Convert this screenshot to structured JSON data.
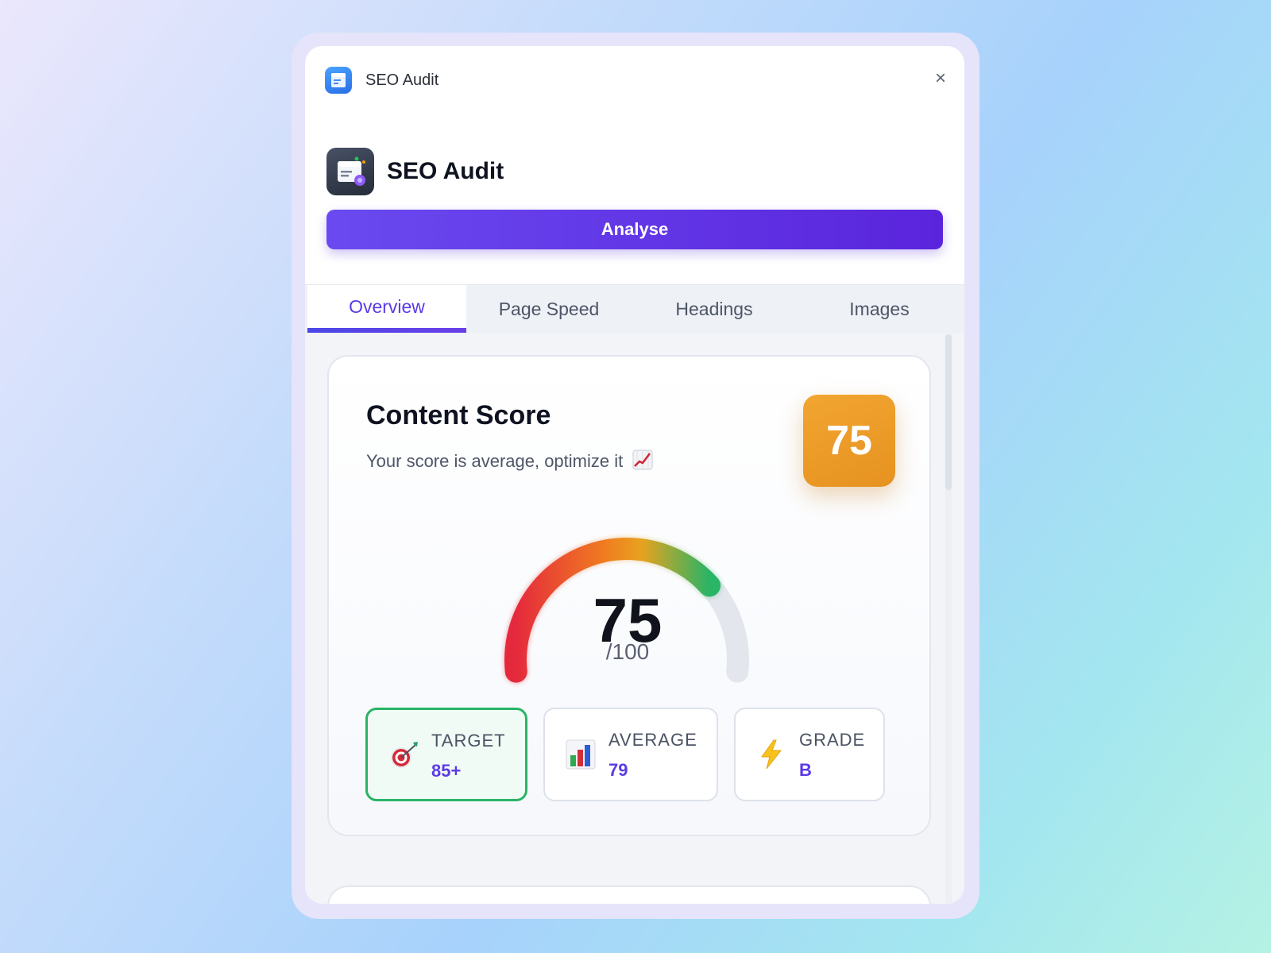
{
  "window": {
    "title": "SEO Audit",
    "close_glyph": "×",
    "icon": "seo-audit-app-icon"
  },
  "header": {
    "title": "SEO Audit",
    "analyse_label": "Analyse"
  },
  "tabs": [
    {
      "label": "Overview",
      "active": true
    },
    {
      "label": "Page Speed",
      "active": false
    },
    {
      "label": "Headings",
      "active": false
    },
    {
      "label": "Images",
      "active": false
    }
  ],
  "content_score": {
    "title": "Content Score",
    "subtitle": "Your score is average, optimize it",
    "subtitle_icon": "chart-increasing-icon",
    "badge_value": "75",
    "gauge": {
      "value": 75,
      "value_text": "75",
      "max_text": "/100",
      "max": 100,
      "colors": [
        "#e5293d",
        "#f07a20",
        "#e8a21f",
        "#29b466"
      ],
      "track_color": "#e3e6ec"
    },
    "stats": [
      {
        "label": "TARGET",
        "value": "85+",
        "icon": "direct-hit-target-icon",
        "highlighted": true
      },
      {
        "label": "AVERAGE",
        "value": "79",
        "icon": "bar-chart-icon",
        "highlighted": false
      },
      {
        "label": "GRADE",
        "value": "B",
        "icon": "lightning-bolt-icon",
        "highlighted": false
      }
    ]
  },
  "colors": {
    "accent": "#5b3be6",
    "badge": "#eb9a25",
    "success": "#29b466"
  }
}
